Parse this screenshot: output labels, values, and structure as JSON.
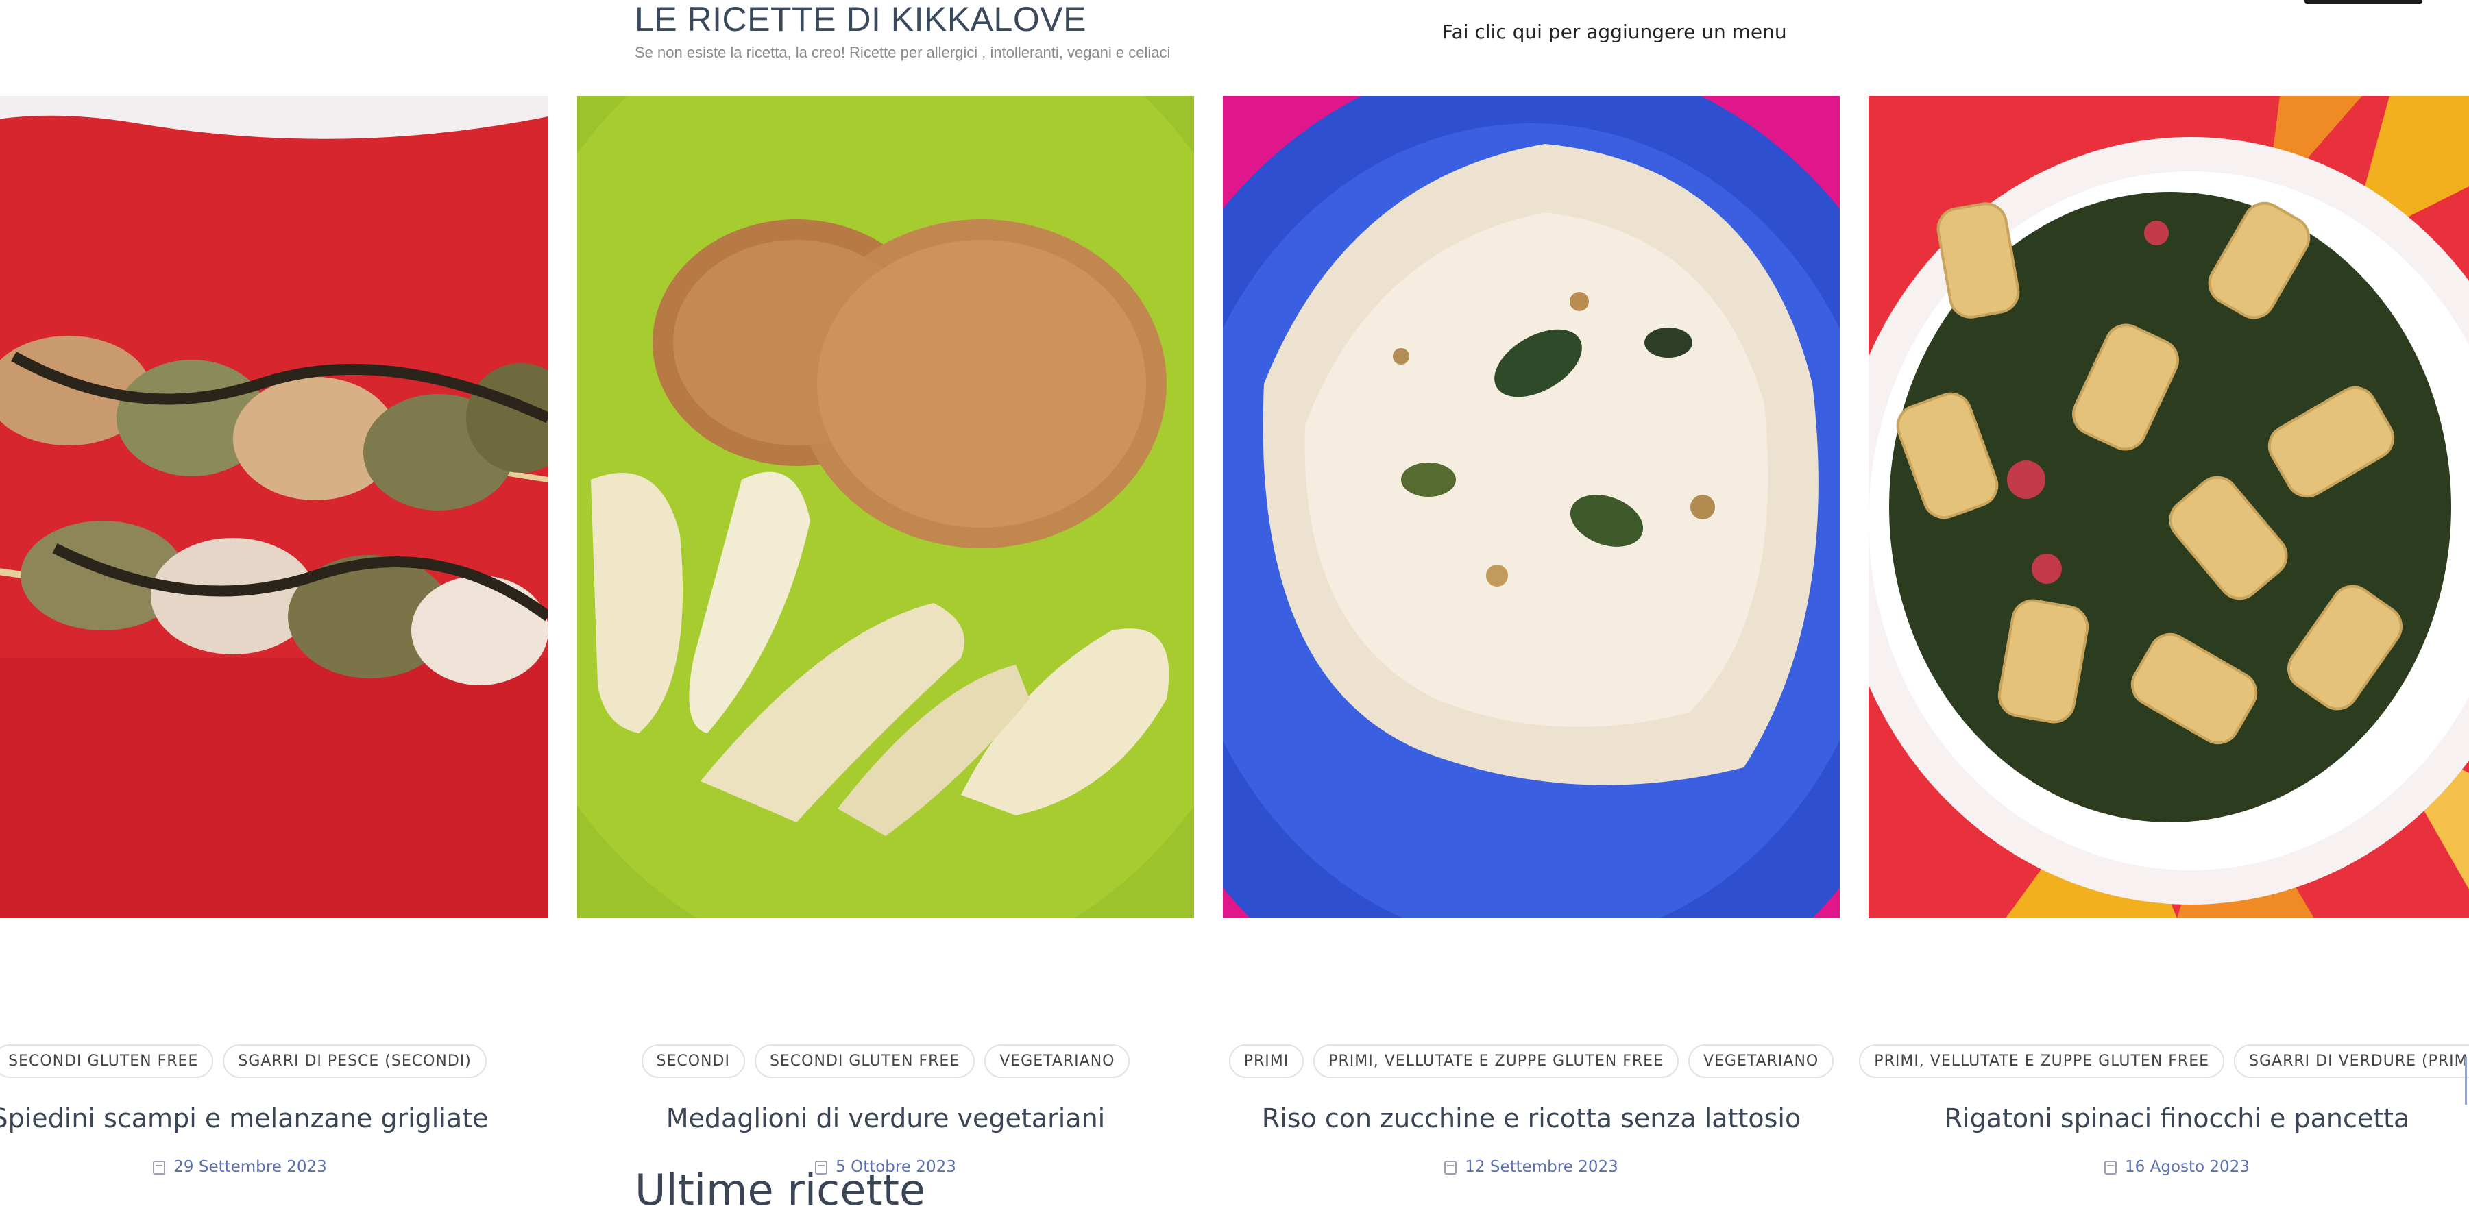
{
  "header": {
    "site_title": "LE RICETTE DI KIKKALOVE",
    "tagline": "Se non esiste la ricetta, la creo! Ricette per allergici , intolleranti, vegani e celiaci",
    "menu_link": "Fai clic qui per aggiungere un menu"
  },
  "posts": [
    {
      "tags": [
        "SECONDI GLUTEN FREE",
        "SGARRI DI PESCE (SECONDI)"
      ],
      "title": "Spiedini scampi e melanzane grigliate",
      "date": "29 Settembre 2023",
      "image_colors": {
        "plate": "#d8262f",
        "accent": "#b01822"
      }
    },
    {
      "tags": [
        "SECONDI",
        "SECONDI GLUTEN FREE",
        "VEGETARIANO"
      ],
      "title": "Medaglioni di verdure vegetariani",
      "date": "5 Ottobre 2023",
      "image_colors": {
        "plate": "#9cc22c",
        "accent": "#7da51c"
      }
    },
    {
      "tags": [
        "PRIMI",
        "PRIMI, VELLUTATE E ZUPPE GLUTEN FREE",
        "VEGETARIANO"
      ],
      "title": "Riso con zucchine e ricotta senza lattosio",
      "date": "12 Settembre 2023",
      "image_colors": {
        "plate": "#2d4fd0",
        "accent": "#e0178a"
      }
    },
    {
      "tags": [
        "PRIMI, VELLUTATE E ZUPPE GLUTEN FREE",
        "SGARRI DI VERDURE (PRIMI)"
      ],
      "title": "Rigatoni spinaci finocchi e pancetta",
      "date": "16 Agosto 2023",
      "image_colors": {
        "plate": "#e8313c",
        "accent": "#f08a24"
      }
    }
  ],
  "section": {
    "title": "Ultime ricette"
  }
}
